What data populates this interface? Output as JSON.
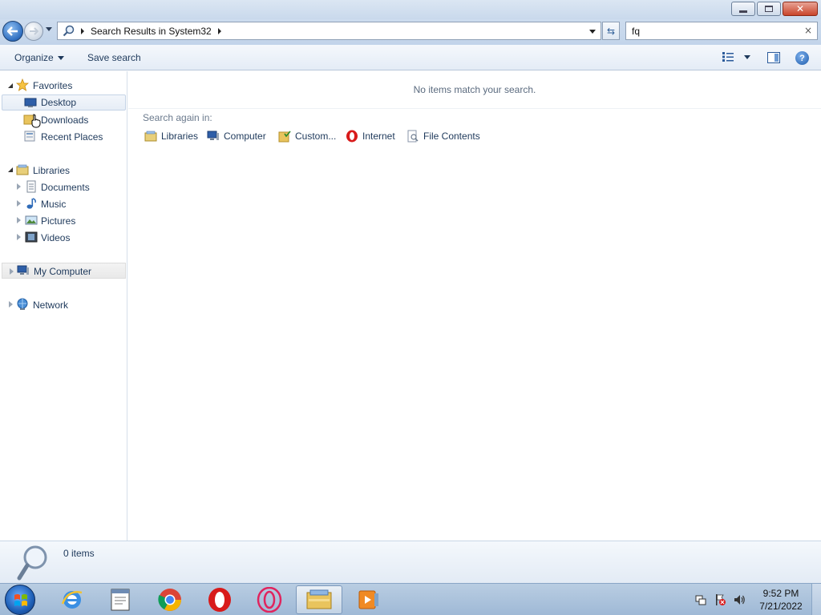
{
  "window": {
    "address": {
      "breadcrumb": "Search Results in System32"
    },
    "search": {
      "value": "fq",
      "clear_glyph": "×"
    },
    "caption_buttons": {
      "close_glyph": "✕"
    },
    "refresh_glyph": "⇆"
  },
  "toolbar": {
    "organize_label": "Organize",
    "save_search_label": "Save search",
    "help_glyph": "?"
  },
  "navpane": {
    "favorites": {
      "label": "Favorites",
      "items": [
        {
          "label": "Desktop",
          "icon": "desktop-icon"
        },
        {
          "label": "Downloads",
          "icon": "downloads-folder-icon"
        },
        {
          "label": "Recent Places",
          "icon": "recent-places-icon"
        }
      ]
    },
    "libraries": {
      "label": "Libraries",
      "items": [
        {
          "label": "Documents",
          "icon": "documents-icon"
        },
        {
          "label": "Music",
          "icon": "music-icon"
        },
        {
          "label": "Pictures",
          "icon": "pictures-icon"
        },
        {
          "label": "Videos",
          "icon": "videos-icon"
        }
      ]
    },
    "computer": {
      "label": "My Computer"
    },
    "network": {
      "label": "Network"
    }
  },
  "content": {
    "empty_message": "No items match your search.",
    "search_again_label": "Search again in:",
    "search_again_options": [
      {
        "label": "Libraries",
        "icon": "libraries-icon"
      },
      {
        "label": "Computer",
        "icon": "computer-icon"
      },
      {
        "label": "Custom...",
        "icon": "custom-folder-icon"
      },
      {
        "label": "Internet",
        "icon": "opera-icon"
      },
      {
        "label": "File Contents",
        "icon": "file-contents-icon"
      }
    ]
  },
  "details": {
    "count": "0 items"
  },
  "taskbar": {
    "items": [
      {
        "name": "internet-explorer",
        "active": false
      },
      {
        "name": "notepad",
        "active": false
      },
      {
        "name": "chrome",
        "active": false
      },
      {
        "name": "opera",
        "active": false
      },
      {
        "name": "opera-gx",
        "active": false
      },
      {
        "name": "windows-explorer",
        "active": true
      },
      {
        "name": "media-player",
        "active": false
      }
    ],
    "clock": {
      "time": "9:52 PM",
      "date": "7/21/2022"
    }
  },
  "colors": {
    "accent": "#1e395b",
    "chrome_red": "#db4437",
    "opera_red": "#d81a1a"
  }
}
